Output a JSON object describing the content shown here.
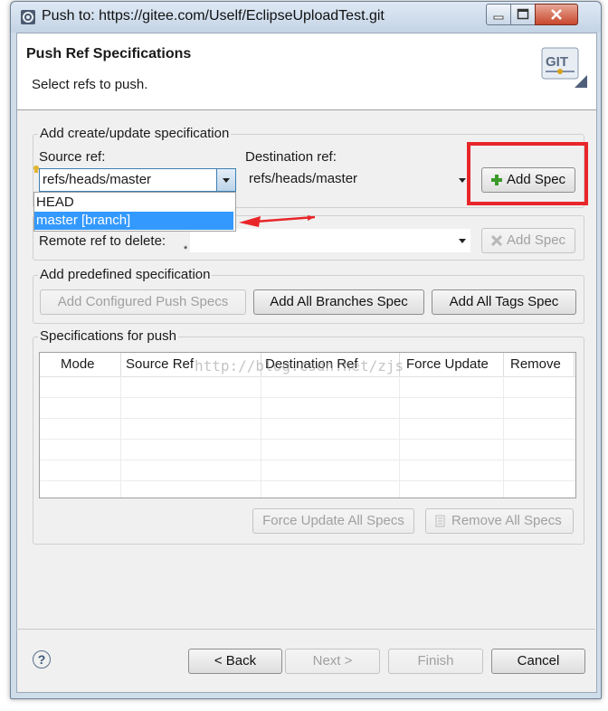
{
  "window": {
    "title": "Push to: https://gitee.com/Uself/EclipseUploadTest.git"
  },
  "header": {
    "title": "Push Ref Specifications",
    "subtitle": "Select refs to push.",
    "logo_text": "GIT"
  },
  "create_group": {
    "label": "Add create/update specification",
    "source_label": "Source ref:",
    "source_value": "refs/heads/master",
    "dest_label": "Destination ref:",
    "dest_value": "refs/heads/master",
    "add_spec_label": "Add Spec",
    "dropdown_options": [
      "HEAD",
      "master [branch]"
    ],
    "selected_option": "master [branch]"
  },
  "delete_group": {
    "remote_label": "Remote ref to delete:",
    "remote_value": "",
    "add_spec_label": "Add Spec"
  },
  "predefined_group": {
    "label": "Add predefined specification",
    "configured_label": "Add Configured Push Specs",
    "branches_label": "Add All Branches Spec",
    "tags_label": "Add All Tags Spec"
  },
  "specs_group": {
    "label": "Specifications for push",
    "columns": [
      "Mode",
      "Source Ref",
      "Destination Ref",
      "Force Update",
      "Remove"
    ],
    "force_update_all_label": "Force Update All Specs",
    "remove_all_label": "Remove All Specs"
  },
  "watermark": "http://blog.csdn.net/zjs",
  "footer": {
    "help_label": "?",
    "back_label": "< Back",
    "next_label": "Next >",
    "finish_label": "Finish",
    "cancel_label": "Cancel"
  },
  "colors": {
    "highlight": "#3399ff",
    "annotation_red": "#e8262a",
    "add_icon_green": "#3a9a2a"
  }
}
